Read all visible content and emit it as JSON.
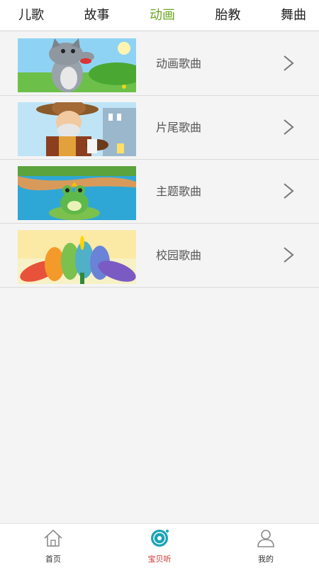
{
  "top_tabs": [
    {
      "label": "儿歌",
      "active": false
    },
    {
      "label": "故事",
      "active": false
    },
    {
      "label": "动画",
      "active": true
    },
    {
      "label": "胎教",
      "active": false
    },
    {
      "label": "舞曲",
      "active": false
    }
  ],
  "list": {
    "items": [
      {
        "label": "动画歌曲",
        "thumb": "cartoon-wolf-image"
      },
      {
        "label": "片尾歌曲",
        "thumb": "cartoon-farmer-image"
      },
      {
        "label": "主题歌曲",
        "thumb": "cartoon-frog-image"
      },
      {
        "label": "校园歌曲",
        "thumb": "cartoon-flower-image"
      }
    ],
    "chevron_icon": "chevron-right-icon"
  },
  "bottom_nav": {
    "items": [
      {
        "label": "首页",
        "icon": "home-icon",
        "active": false
      },
      {
        "label": "宝贝听",
        "icon": "music-disc-icon",
        "active": true
      },
      {
        "label": "我的",
        "icon": "user-icon",
        "active": false
      }
    ]
  },
  "colors": {
    "active_tab": "#6aa61f",
    "active_nav": "#c9302c",
    "background": "#f4f4f4"
  }
}
